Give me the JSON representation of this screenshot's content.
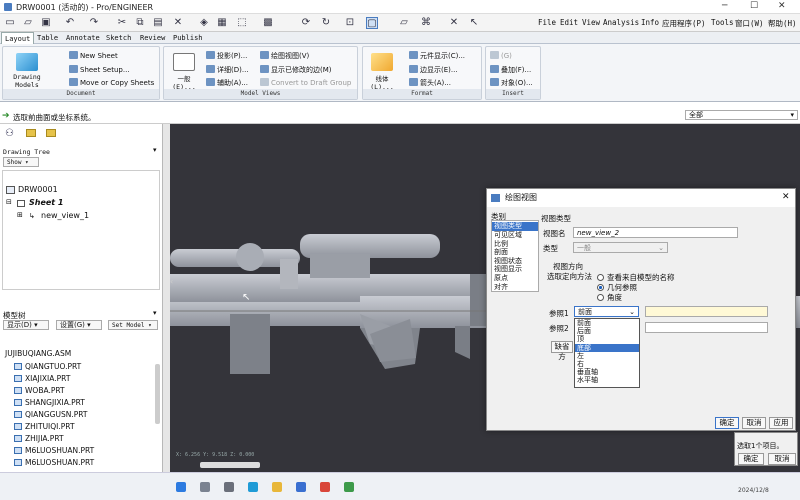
{
  "window": {
    "title": "DRW0001 (活动的) - Pro/ENGINEER"
  },
  "menubar": [
    "File",
    "Edit",
    "View",
    "Analysis",
    "Info",
    "应用程序(P)",
    "Tools",
    "窗口(W)",
    "帮助(H)"
  ],
  "tabs": [
    "Layout",
    "Table",
    "Annotate",
    "Sketch",
    "Review",
    "Publish"
  ],
  "ribbon": {
    "document": {
      "label": "Document",
      "big": "Drawing Models",
      "items": [
        "New Sheet",
        "Sheet Setup...",
        "Move or Copy Sheets"
      ]
    },
    "model_views": {
      "label": "Model Views",
      "big": "一般(E)...",
      "items": [
        "投影(P)...",
        "详细(D)...",
        "辅助(A)...",
        "绘图视图(V)",
        "显示已修改的边(M)",
        "Convert to Draft Group"
      ]
    },
    "format": {
      "label": "Format",
      "big": "线体(L)...",
      "items": [
        "元件显示(C)...",
        "边显示(E)...",
        "箭头(A)..."
      ]
    },
    "insert": {
      "label": "Insert",
      "items": [
        "(G)",
        "叠加(F)...",
        "对象(O)..."
      ]
    }
  },
  "status": {
    "message": "选取前曲面或坐标系统。",
    "filter": "全部"
  },
  "drawing_tree": {
    "title": "Drawing Tree",
    "show": "Show ▾",
    "root": "DRW0001",
    "sheet": "Sheet 1",
    "view": "new_view_1"
  },
  "model_tree": {
    "title": "模型树",
    "buttons": [
      "显示(D) ▾",
      "设置(G) ▾",
      "Set Model ▾"
    ],
    "root": "JUJIBUQIANG.ASM",
    "parts": [
      "QIANGTUO.PRT",
      "XIAJIXIA.PRT",
      "WOBA.PRT",
      "SHANGJIXIA.PRT",
      "QIANGGUSN.PRT",
      "ZHITUIQI.PRT",
      "ZHIJIA.PRT",
      "M6LUOSHUAN.PRT",
      "M6LUOSHUAN.PRT"
    ]
  },
  "dialog": {
    "title": "绘图视图",
    "category_label": "类别",
    "categories": [
      "视图类型",
      "可见区域",
      "比例",
      "剖面",
      "视图状态",
      "视图显示",
      "原点",
      "对齐"
    ],
    "section_title": "视图类型",
    "view_name_label": "视图名",
    "view_name": "new_view_2",
    "type_label": "类型",
    "type_value": "一般",
    "orientation_title": "视图方向",
    "method_label": "选取定向方法",
    "methods": [
      "查看来自模型的名称",
      "几何参照",
      "角度"
    ],
    "ref1_label": "参照1",
    "ref1_value": "前面",
    "ref2_label": "参照2",
    "default_label": "缺省方",
    "options": [
      "前面",
      "后面",
      "顶",
      "底部",
      "左",
      "右",
      "垂直轴",
      "水平轴"
    ],
    "buttons": [
      "确定",
      "取消",
      "应用"
    ]
  },
  "mini_dialog": {
    "text": "选取1个项目。",
    "ok": "确定",
    "cancel": "取消"
  },
  "viewport": {
    "coords": "X: 6.256   Y: 9.518   Z: 0.000"
  },
  "clock": "2024/12/8"
}
